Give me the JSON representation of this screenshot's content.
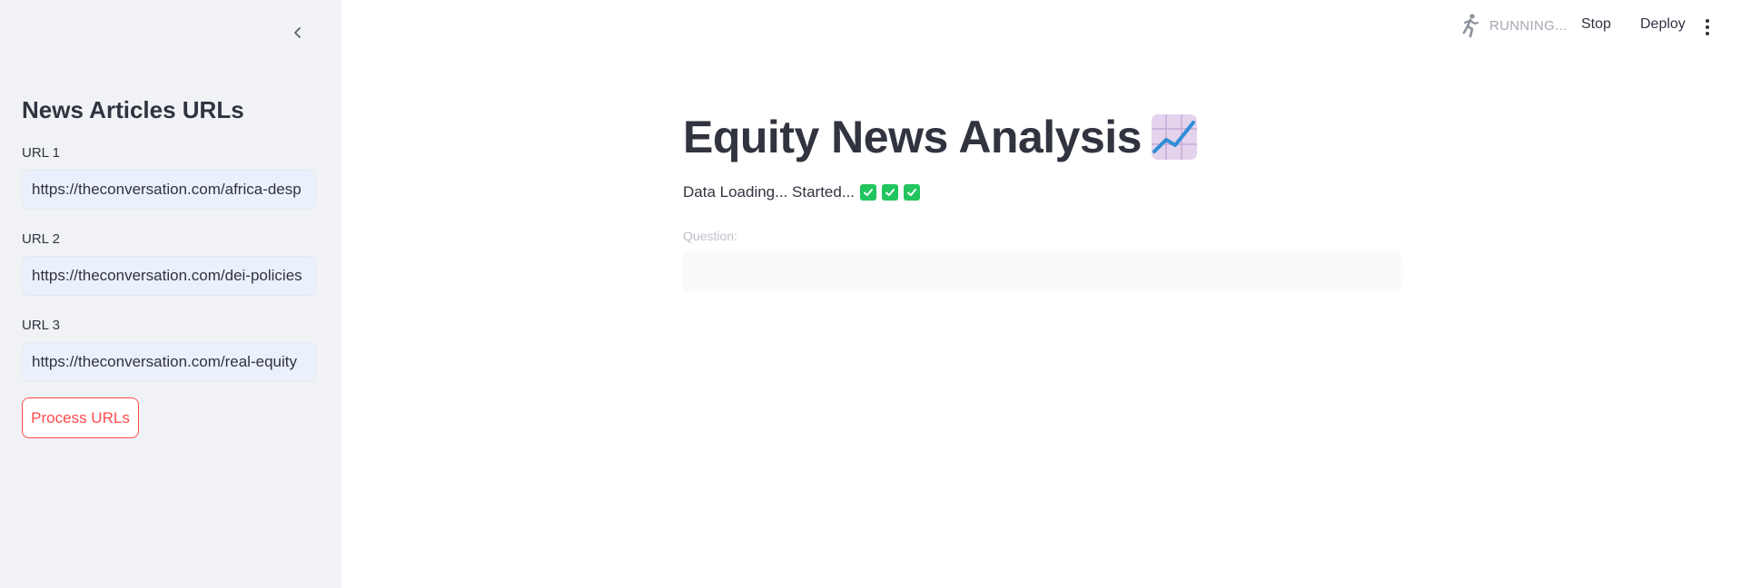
{
  "sidebar": {
    "title": "News Articles URLs",
    "urls": [
      {
        "label": "URL 1",
        "value": "https://theconversation.com/africa-desp"
      },
      {
        "label": "URL 2",
        "value": "https://theconversation.com/dei-policies"
      },
      {
        "label": "URL 3",
        "value": "https://theconversation.com/real-equity"
      }
    ],
    "process_button": "Process URLs",
    "collapse_icon": "chevron-left-icon"
  },
  "topbar": {
    "status_icon": "running-person-icon",
    "status_text": "RUNNING...",
    "stop_label": "Stop",
    "deploy_label": "Deploy",
    "menu_icon": "vertical-dots-icon"
  },
  "main": {
    "title": "Equity News Analysis",
    "title_icon": "chart-increasing-icon",
    "status_text": "Data Loading... Started...",
    "status_checks": 3,
    "question_label": "Question:",
    "question_value": ""
  },
  "colors": {
    "accent": "#ff4b4b",
    "sidebar_bg": "#f0f2f6",
    "input_bg": "#eaf1fc",
    "check_green": "#22c55e",
    "text": "#31333f"
  }
}
